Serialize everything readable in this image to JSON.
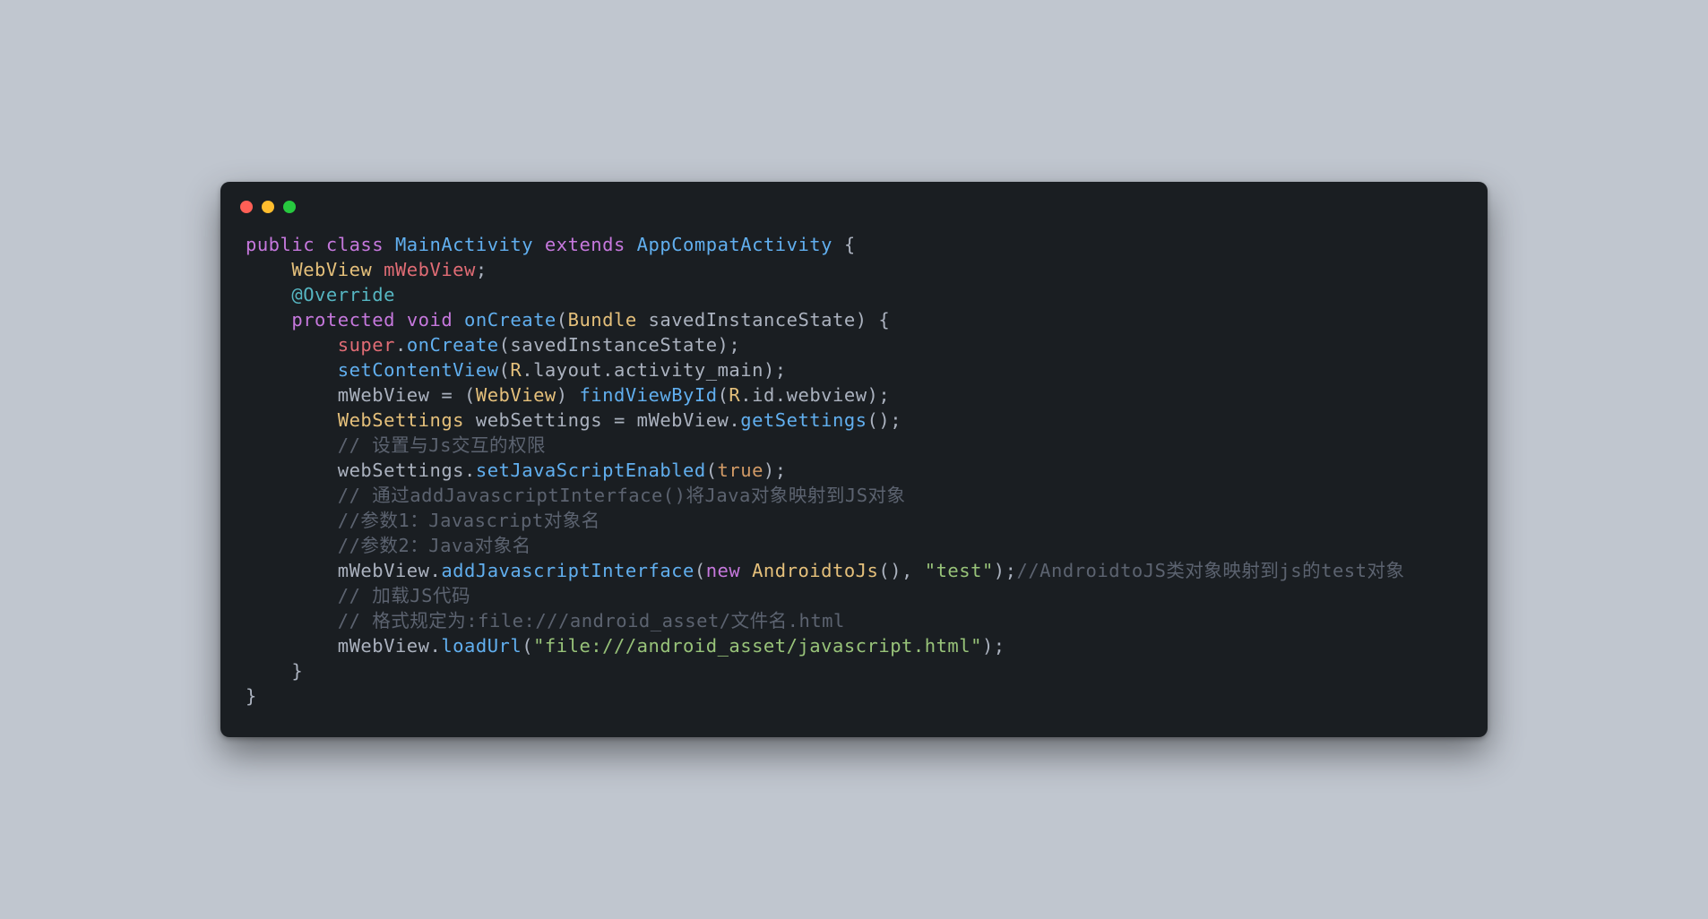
{
  "window": {
    "dots": [
      "red",
      "yellow",
      "green"
    ]
  },
  "code": {
    "l1": {
      "public": "public",
      "class": "class",
      "main": "MainActivity",
      "extends": "extends",
      "app": "AppCompatActivity",
      "brace": " {"
    },
    "l2": {
      "indent": "    ",
      "type": "WebView",
      "var": " mWebView",
      "semi": ";"
    },
    "l3": {
      "indent": "    ",
      "ann": "@Override"
    },
    "l4": {
      "indent": "    ",
      "prot": "protected",
      "void": "void",
      "on": "onCreate",
      "open": "(",
      "bundle": "Bundle",
      "param": " savedInstanceState",
      "close": ") {"
    },
    "l5": {
      "indent": "        ",
      "super": "super",
      "dot": ".",
      "on": "onCreate",
      "args": "(savedInstanceState);"
    },
    "l6": {
      "indent": "        ",
      "fn": "setContentView",
      "open": "(",
      "r": "R",
      "dot1": ".",
      "layout": "layout",
      "dot2": ".",
      "act": "activity_main",
      "close": ");"
    },
    "l7": {
      "indent": "        ",
      "mw": "mWebView",
      "eq": " = (",
      "wv": "WebView",
      "close": ") ",
      "fn": "findViewById",
      "open": "(",
      "r": "R",
      "dot": ".",
      "id": "id",
      "dot2": ".",
      "webview": "webview",
      "end": ");"
    },
    "l8": {
      "indent": "        ",
      "ws": "WebSettings",
      "var": " webSettings = ",
      "mw": "mWebView",
      "dot": ".",
      "fn": "getSettings",
      "end": "();"
    },
    "l9": {
      "indent": "        ",
      "cmt": "// 设置与Js交互的权限"
    },
    "l10": {
      "indent": "        ",
      "ws": "webSettings",
      "dot": ".",
      "fn": "setJavaScriptEnabled",
      "open": "(",
      "true": "true",
      "end": ");"
    },
    "l11": {
      "indent": "        ",
      "cmt": "// 通过addJavascriptInterface()将Java对象映射到JS对象"
    },
    "l12": {
      "indent": "        ",
      "cmt": "//参数1：Javascript对象名"
    },
    "l13": {
      "indent": "        ",
      "cmt": "//参数2：Java对象名"
    },
    "l14": {
      "indent": "        ",
      "mw": "mWebView",
      "dot": ".",
      "fn": "addJavascriptInterface",
      "open": "(",
      "new": "new",
      "cls": " AndroidtoJs",
      "args": "(), ",
      "str": "\"test\"",
      "end": ");",
      "tail": "//AndroidtoJS类对象映射到js的test对象"
    },
    "l15": {
      "indent": "        ",
      "cmt": "// 加载JS代码"
    },
    "l16": {
      "indent": "        ",
      "cmt": "// 格式规定为:file:///android_asset/文件名.html"
    },
    "l17": {
      "indent": "        ",
      "mw": "mWebView",
      "dot": ".",
      "fn": "loadUrl",
      "open": "(",
      "str": "\"file:///android_asset/javascript.html\"",
      "end": ");"
    },
    "l18": {
      "indent": "    ",
      "brace": "}"
    },
    "l19": {
      "brace": "}"
    }
  }
}
